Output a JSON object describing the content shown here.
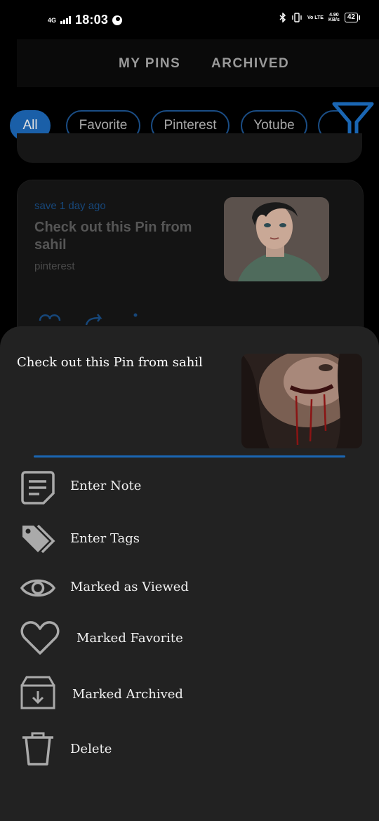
{
  "status_bar": {
    "network": "4G",
    "time": "18:03",
    "volte": "Vo LTE",
    "speed_value": "4.90",
    "speed_unit": "KB/s",
    "battery": "42"
  },
  "tabs": [
    {
      "label": "MY PINS"
    },
    {
      "label": "ARCHIVED"
    }
  ],
  "chips": [
    {
      "label": "All",
      "active": true
    },
    {
      "label": "Favorite"
    },
    {
      "label": "Pinterest"
    },
    {
      "label": "Yotube"
    }
  ],
  "card": {
    "time": "save 1 day ago",
    "title": "Check out this Pin from sahil",
    "source": "pinterest"
  },
  "sheet": {
    "title": "Check out this Pin from sahil",
    "menu": [
      {
        "label": "Enter Note",
        "icon": "note-icon"
      },
      {
        "label": "Enter Tags",
        "icon": "tags-icon"
      },
      {
        "label": "Marked as Viewed",
        "icon": "eye-icon"
      },
      {
        "label": "Marked Favorite",
        "icon": "heart-icon"
      },
      {
        "label": "Marked Archived",
        "icon": "archive-icon"
      },
      {
        "label": "Delete",
        "icon": "trash-icon"
      }
    ]
  },
  "colors": {
    "accent": "#1a66b3",
    "sheet_bg": "#222222",
    "background": "#000000"
  }
}
